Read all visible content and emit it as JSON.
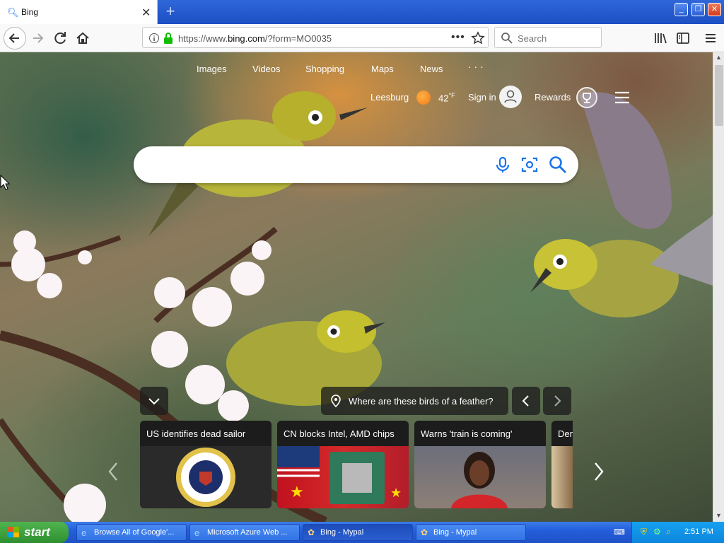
{
  "browser": {
    "tab_title": "Bing",
    "url_prefix": "https://www.",
    "url_host": "bing.com",
    "url_rest": "/?form=MO0035",
    "search_placeholder": "Search"
  },
  "bing": {
    "nav": [
      "Images",
      "Videos",
      "Shopping",
      "Maps",
      "News"
    ],
    "more": "· · ·",
    "location": "Leesburg",
    "temperature": "42",
    "temp_unit": "°F",
    "sign_in": "Sign in",
    "rewards": "Rewards",
    "caption": "Where are these birds of a feather?",
    "news": [
      {
        "title": "US identifies dead sailor"
      },
      {
        "title": "CN blocks Intel, AMD chips"
      },
      {
        "title": "Warns 'train is coming'"
      },
      {
        "title": "Den"
      }
    ]
  },
  "taskbar": {
    "start": "start",
    "tasks": [
      "Browse All of Google'...",
      "Microsoft Azure Web ...",
      "Bing - Mypal",
      "Bing - Mypal"
    ],
    "clock": "2:51 PM"
  },
  "colors": {
    "bing_blue": "#1a73e8",
    "xp_taskbar": "#245edb",
    "start_green": "#3a9a3a"
  }
}
